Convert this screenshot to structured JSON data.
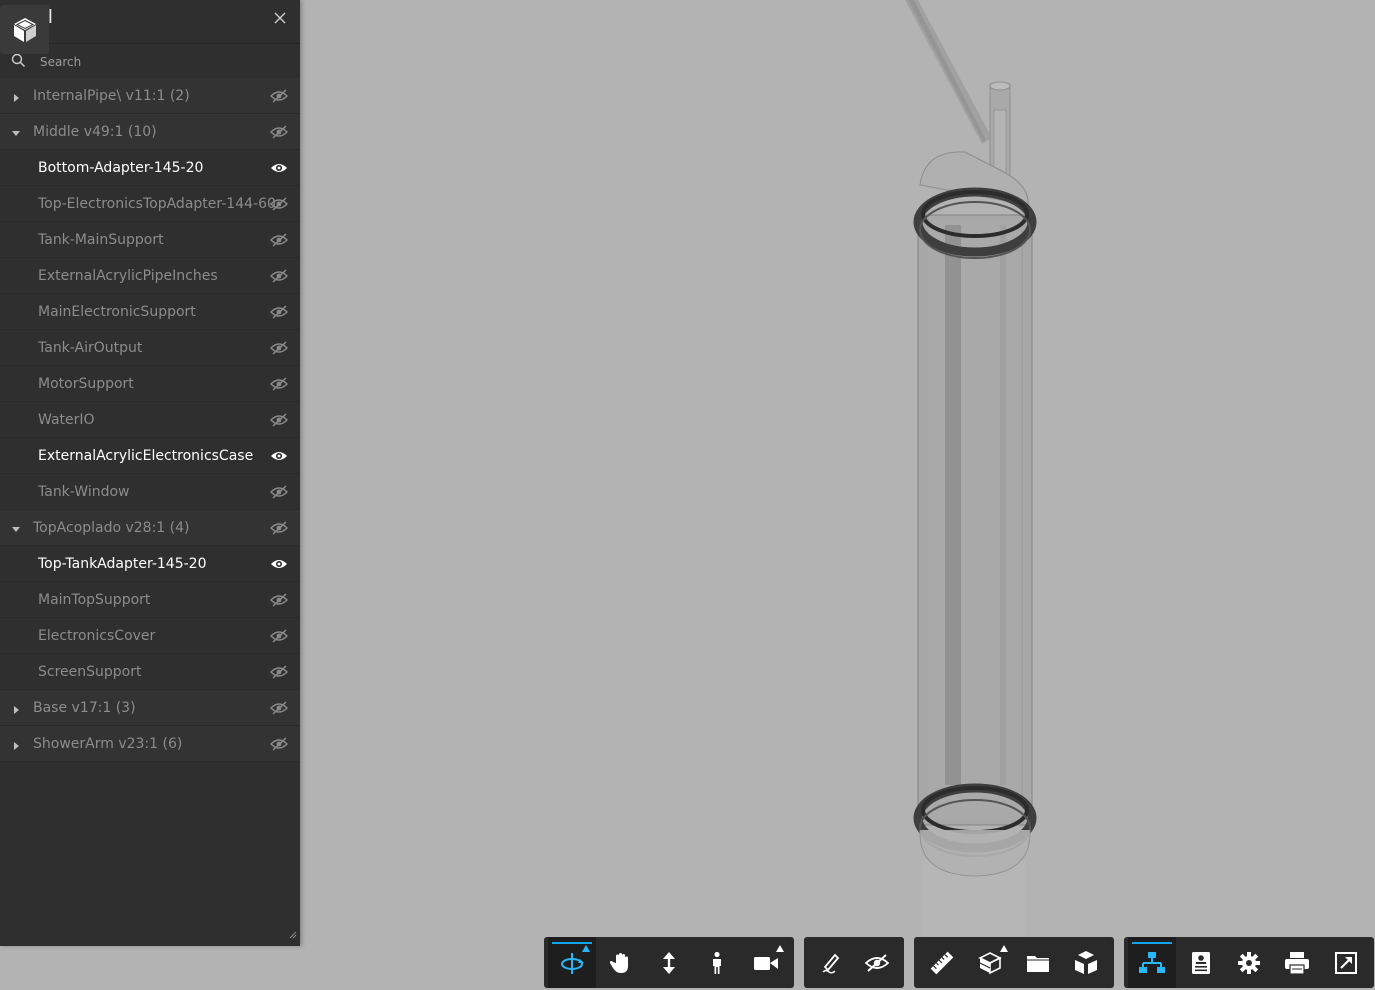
{
  "panel": {
    "title": "del",
    "search_placeholder": "Search",
    "rows": [
      {
        "label": "InternalPipe\\ v11:1 (2)",
        "type": "group",
        "expanded": false,
        "visible": false
      },
      {
        "label": "Middle v49:1 (10)",
        "type": "group",
        "expanded": true,
        "visible": false
      },
      {
        "label": "Bottom-Adapter-145-20",
        "type": "leaf",
        "visible": true
      },
      {
        "label": "Top-ElectronicsTopAdapter-144-60",
        "type": "leaf",
        "visible": false
      },
      {
        "label": "Tank-MainSupport",
        "type": "leaf",
        "visible": false
      },
      {
        "label": "ExternalAcrylicPipeInches",
        "type": "leaf",
        "visible": false
      },
      {
        "label": "MainElectronicSupport",
        "type": "leaf",
        "visible": false
      },
      {
        "label": "Tank-AirOutput",
        "type": "leaf",
        "visible": false
      },
      {
        "label": "MotorSupport",
        "type": "leaf",
        "visible": false
      },
      {
        "label": "WaterIO",
        "type": "leaf",
        "visible": false
      },
      {
        "label": "ExternalAcrylicElectronicsCase",
        "type": "leaf",
        "visible": true
      },
      {
        "label": "Tank-Window",
        "type": "leaf",
        "visible": false
      },
      {
        "label": "TopAcoplado v28:1 (4)",
        "type": "group",
        "expanded": true,
        "visible": false
      },
      {
        "label": "Top-TankAdapter-145-20",
        "type": "leaf",
        "visible": true
      },
      {
        "label": "MainTopSupport",
        "type": "leaf",
        "visible": false
      },
      {
        "label": "ElectronicsCover",
        "type": "leaf",
        "visible": false
      },
      {
        "label": "ScreenSupport",
        "type": "leaf",
        "visible": false
      },
      {
        "label": "Base v17:1 (3)",
        "type": "group",
        "expanded": false,
        "visible": false
      },
      {
        "label": "ShowerArm v23:1 (6)",
        "type": "group",
        "expanded": false,
        "visible": false
      }
    ]
  },
  "toolbar": {
    "accent": "#0ea5e9",
    "groups": [
      {
        "name": "navigation",
        "tools": [
          {
            "icon": "orbit-icon",
            "active": true,
            "flyout": true
          },
          {
            "icon": "pan-hand-icon",
            "active": false,
            "flyout": false
          },
          {
            "icon": "zoom-arrows-icon",
            "active": false,
            "flyout": false
          },
          {
            "icon": "first-person-icon",
            "active": false,
            "flyout": false
          },
          {
            "icon": "camera-icon",
            "active": false,
            "flyout": true
          }
        ]
      },
      {
        "name": "markup",
        "tools": [
          {
            "icon": "markup-pen-icon",
            "active": false,
            "flyout": false
          },
          {
            "icon": "hide-eye-icon",
            "active": false,
            "flyout": false
          }
        ]
      },
      {
        "name": "measure",
        "tools": [
          {
            "icon": "ruler-icon",
            "active": false,
            "flyout": false
          },
          {
            "icon": "section-cube-icon",
            "active": false,
            "flyout": true
          },
          {
            "icon": "folder-icon",
            "active": false,
            "flyout": false
          },
          {
            "icon": "explode-cube-icon",
            "active": false,
            "flyout": false
          }
        ]
      },
      {
        "name": "settings",
        "tools": [
          {
            "icon": "model-tree-icon",
            "active": true,
            "flyout": false
          },
          {
            "icon": "properties-icon",
            "active": false,
            "flyout": false
          },
          {
            "icon": "settings-gear-icon",
            "active": false,
            "flyout": false
          },
          {
            "icon": "print-icon",
            "active": false,
            "flyout": false
          },
          {
            "icon": "fullscreen-icon",
            "active": false,
            "flyout": false
          }
        ]
      }
    ]
  }
}
